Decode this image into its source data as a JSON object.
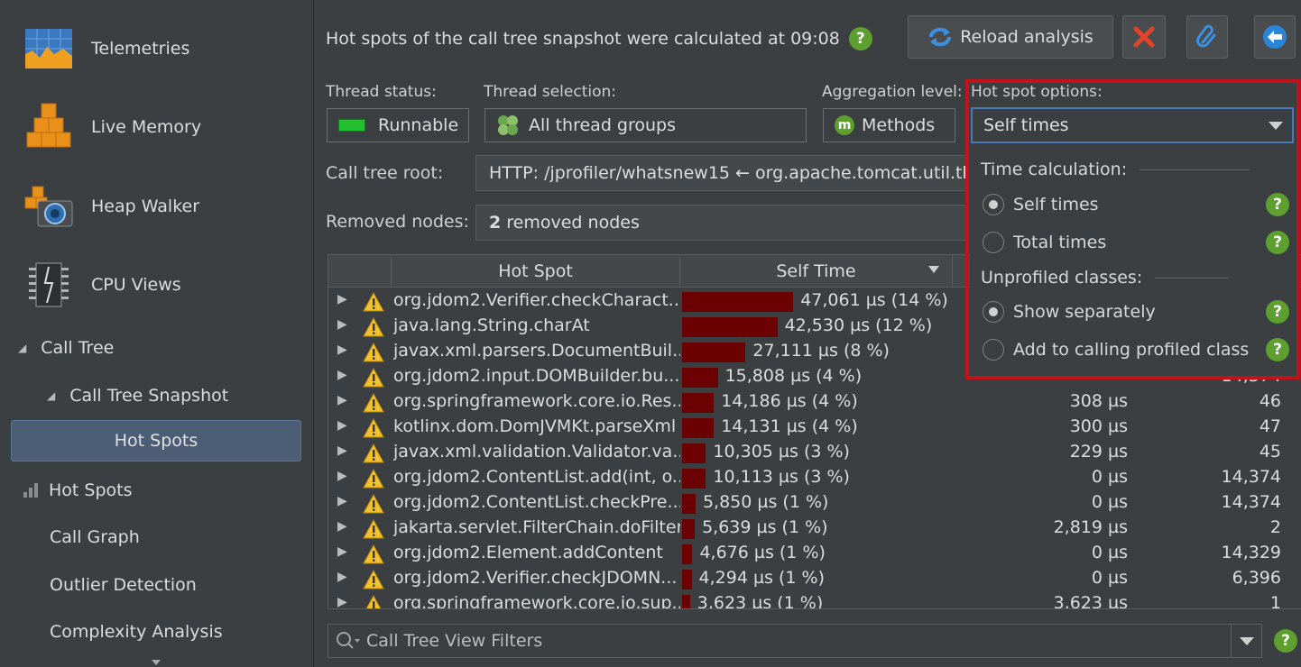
{
  "sidebar": {
    "big_items": [
      {
        "label": "Telemetries",
        "icon": "telemetries-icon"
      },
      {
        "label": "Live Memory",
        "icon": "live-memory-icon"
      },
      {
        "label": "Heap Walker",
        "icon": "heap-walker-icon"
      },
      {
        "label": "CPU Views",
        "icon": "cpu-views-icon"
      }
    ],
    "call_tree": "Call Tree",
    "call_tree_snapshot": "Call Tree Snapshot",
    "selected": "Hot Spots",
    "hot_spots": "Hot Spots",
    "call_graph": "Call Graph",
    "outlier_detection": "Outlier Detection",
    "complexity_analysis": "Complexity Analysis"
  },
  "header": {
    "title": "Hot spots of the call tree snapshot were calculated at 09:08",
    "reload_label": "Reload analysis"
  },
  "controls": {
    "thread_status_label": "Thread status:",
    "thread_status_value": "Runnable",
    "thread_selection_label": "Thread selection:",
    "thread_selection_value": "All thread groups",
    "aggregation_label": "Aggregation level:",
    "aggregation_value": "Methods",
    "aggregation_badge": "m",
    "call_tree_root_label": "Call tree root:",
    "call_tree_root_value": "HTTP: /jprofiler/whatsnew15 ← org.apache.tomcat.util.thr",
    "removed_nodes_label": "Removed nodes:",
    "removed_nodes_count": "2",
    "removed_nodes_text": "removed nodes"
  },
  "table": {
    "headers": {
      "hot_spot": "Hot Spot",
      "self_time": "Self Time"
    },
    "rows": [
      {
        "name": "org.jdom2.Verifier.checkCharact...",
        "self": "47,061 µs (14 %)",
        "pct": 14,
        "c3": "",
        "c4": ""
      },
      {
        "name": "java.lang.String.charAt",
        "self": "42,530 µs (12 %)",
        "pct": 12,
        "c3": "",
        "c4": ""
      },
      {
        "name": "javax.xml.parsers.DocumentBuil...",
        "self": "27,111 µs (8 %)",
        "pct": 8,
        "c3": "",
        "c4": ""
      },
      {
        "name": "org.jdom2.input.DOMBuilder.bu...",
        "self": "15,808 µs (4 %)",
        "pct": 4.5,
        "c3": "",
        "c4": "14,374"
      },
      {
        "name": "org.springframework.core.io.Res...",
        "self": "14,186 µs (4 %)",
        "pct": 4,
        "c3": "308 µs",
        "c4": "46"
      },
      {
        "name": "kotlinx.dom.DomJVMKt.parseXml",
        "self": "14,131 µs (4 %)",
        "pct": 4,
        "c3": "300 µs",
        "c4": "47"
      },
      {
        "name": "javax.xml.validation.Validator.va...",
        "self": "10,305 µs (3 %)",
        "pct": 3,
        "c3": "229 µs",
        "c4": "45"
      },
      {
        "name": "org.jdom2.ContentList.add(int, o...",
        "self": "10,113 µs (3 %)",
        "pct": 3,
        "c3": "0 µs",
        "c4": "14,374"
      },
      {
        "name": "org.jdom2.ContentList.checkPre...",
        "self": "5,850 µs (1 %)",
        "pct": 1.7,
        "c3": "0 µs",
        "c4": "14,374"
      },
      {
        "name": "jakarta.servlet.FilterChain.doFilter",
        "self": "5,639 µs (1 %)",
        "pct": 1.6,
        "c3": "2,819 µs",
        "c4": "2"
      },
      {
        "name": "org.jdom2.Element.addContent",
        "self": "4,676 µs (1 %)",
        "pct": 1.3,
        "c3": "0 µs",
        "c4": "14,329"
      },
      {
        "name": "org.jdom2.Verifier.checkJDOMN...",
        "self": "4,294 µs (1 %)",
        "pct": 1.2,
        "c3": "0 µs",
        "c4": "6,396"
      },
      {
        "name": "org.springframework.core.io.sup...",
        "self": "3,623 µs (1 %)",
        "pct": 1,
        "c3": "3,623 µs",
        "c4": "1"
      }
    ]
  },
  "popup": {
    "label": "Hot spot options:",
    "selected": "Self times",
    "time_calc_label": "Time calculation:",
    "opt_self": "Self times",
    "opt_total": "Total times",
    "unprofiled_label": "Unprofiled classes:",
    "opt_separately": "Show separately",
    "opt_add": "Add to calling profiled class"
  },
  "filter": {
    "placeholder": "Call Tree View Filters"
  },
  "help_glyph": "?",
  "colors": {
    "accent": "#4a7ab5",
    "help": "#5ea030",
    "bar": "#6b0000",
    "highlight": "#c4121a",
    "selected_nav": "#4b5e75"
  }
}
